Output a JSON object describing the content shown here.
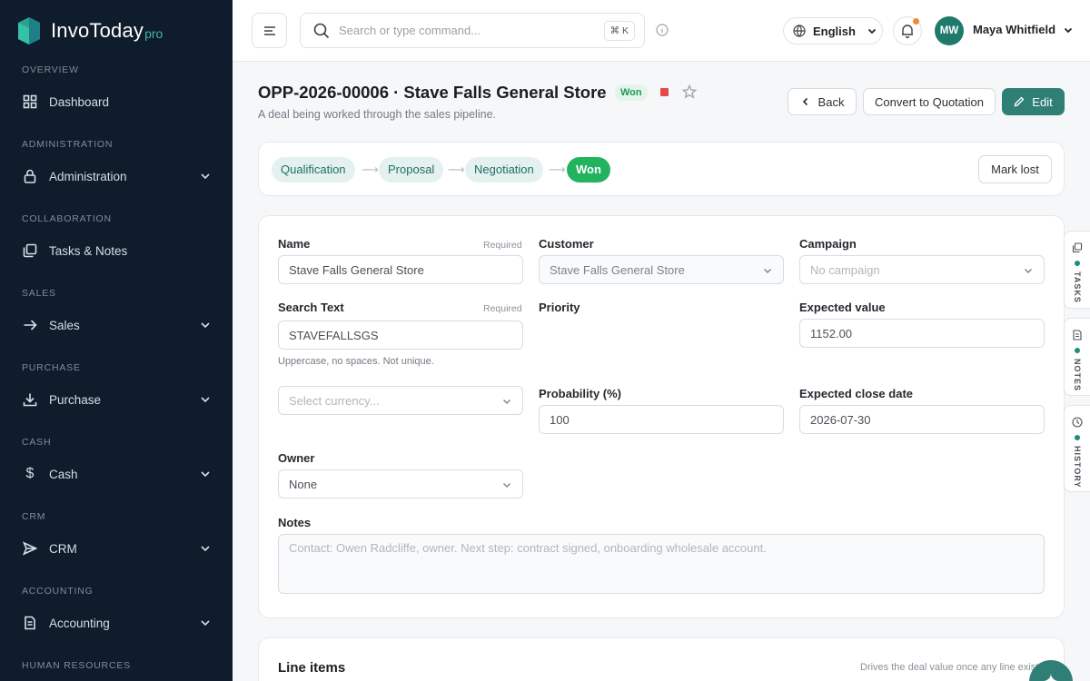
{
  "app": {
    "name": "InvoToday",
    "suffix": "pro"
  },
  "sidebar": {
    "sections": [
      {
        "title": "Overview",
        "item": "Dashboard"
      },
      {
        "title": "Administration",
        "item": "Administration"
      },
      {
        "title": "Collaboration",
        "item": "Tasks & Notes"
      },
      {
        "title": "Sales",
        "item": "Sales"
      },
      {
        "title": "Purchase",
        "item": "Purchase"
      },
      {
        "title": "Cash",
        "item": "Cash"
      },
      {
        "title": "CRM",
        "item": "CRM"
      },
      {
        "title": "Accounting",
        "item": "Accounting"
      },
      {
        "title": "Human Resources",
        "item": ""
      }
    ]
  },
  "topbar": {
    "search_placeholder": "Search or type command...",
    "shortcut": "⌘ K",
    "language": "English",
    "user_initials": "MW",
    "user_name": "Maya Whitfield"
  },
  "header": {
    "title": "OPP-2026-00006 · Stave Falls General Store",
    "status": "Won",
    "subtitle": "A deal being worked through the sales pipeline.",
    "back_label": "Back",
    "convert_label": "Convert to Quotation",
    "edit_label": "Edit"
  },
  "pipeline": {
    "stages": [
      "Qualification",
      "Proposal",
      "Negotiation",
      "Won"
    ],
    "active": "Won",
    "mark_lost_label": "Mark lost"
  },
  "form": {
    "name_label": "Name",
    "name_required": "Required",
    "name_value": "Stave Falls General Store",
    "customer_label": "Customer",
    "customer_value": "Stave Falls General Store",
    "campaign_label": "Campaign",
    "campaign_placeholder": "No campaign",
    "search_text_label": "Search Text",
    "search_text_required": "Required",
    "search_text_value": "STAVEFALLSGS",
    "search_text_help": "Uppercase, no spaces. Not unique.",
    "priority_label": "Priority",
    "expected_value_label": "Expected value",
    "expected_value": "1152.00",
    "currency_placeholder": "Select currency...",
    "probability_label": "Probability (%)",
    "probability_value": "100",
    "close_date_label": "Expected close date",
    "close_date_value": "2026-07-30",
    "owner_label": "Owner",
    "owner_value": "None",
    "notes_label": "Notes",
    "notes_value": "Contact: Owen Radcliffe, owner. Next step: contract signed, onboarding wholesale account."
  },
  "line_items": {
    "title": "Line items",
    "note": "Drives the deal value once any line exists."
  },
  "rail": {
    "tasks": "TASKS",
    "notes": "NOTES",
    "history": "HISTORY"
  },
  "colors": {
    "accent": "#2f7f77",
    "won": "#22b35f",
    "sidebar": "#0f1c2b"
  }
}
